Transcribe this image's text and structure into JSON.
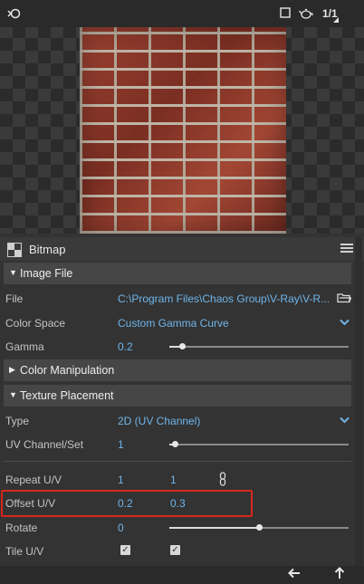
{
  "toolbar": {
    "channel_icon": "channel-swap-icon",
    "square_icon": "square-icon",
    "teapot_icon": "teapot-icon",
    "zoom_label": "1/1"
  },
  "panel": {
    "title": "Bitmap"
  },
  "sections": {
    "image_file": "Image File",
    "color_manipulation": "Color Manipulation",
    "texture_placement": "Texture Placement"
  },
  "image_file": {
    "file_label": "File",
    "file_value": "C:\\Program Files\\Chaos Group\\V-Ray\\V-R...",
    "color_space_label": "Color Space",
    "color_space_value": "Custom Gamma Curve",
    "gamma_label": "Gamma",
    "gamma_value": "0.2"
  },
  "texture": {
    "type_label": "Type",
    "type_value": "2D (UV Channel)",
    "uv_channel_label": "UV Channel/Set",
    "uv_channel_value": "1",
    "repeat_label": "Repeat U/V",
    "repeat_u": "1",
    "repeat_v": "1",
    "offset_label": "Offset U/V",
    "offset_u": "0.2",
    "offset_v": "0.3",
    "rotate_label": "Rotate",
    "rotate_value": "0",
    "tile_label": "Tile U/V",
    "tile_u": true,
    "tile_v": true
  },
  "sliders": {
    "gamma_fraction": 0.07,
    "uv_channel_fraction": 0.03,
    "rotate_fraction": 0.5
  },
  "colors": {
    "accent": "#6fb5ea",
    "highlight": "#d8261d",
    "background": "#333333"
  }
}
